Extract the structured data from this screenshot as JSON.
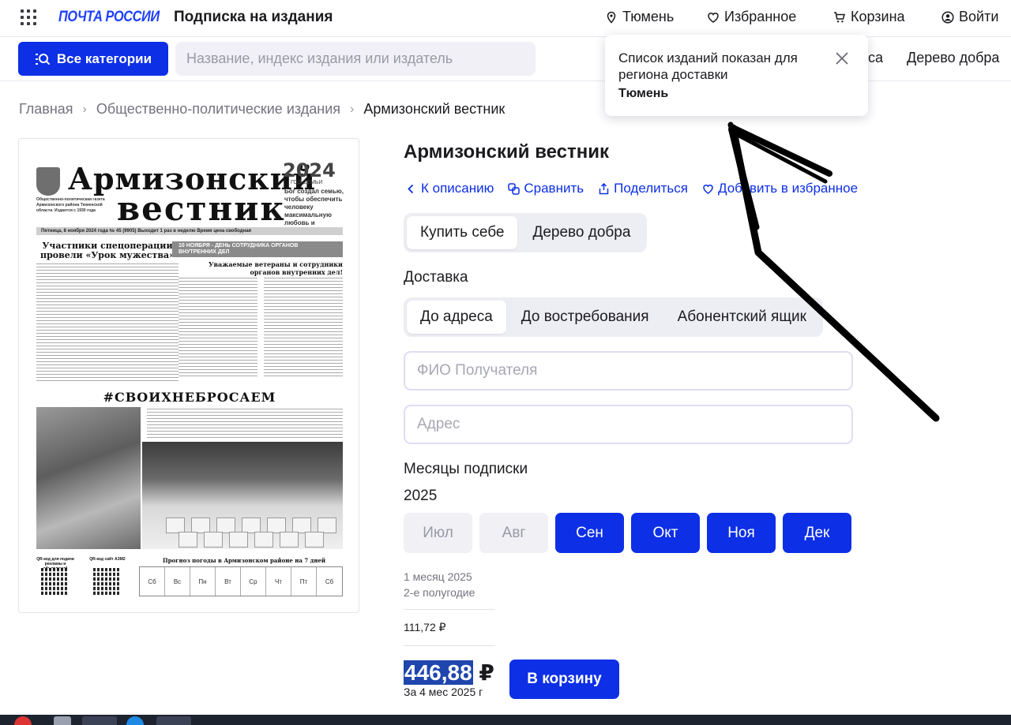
{
  "header": {
    "logo": "ПОЧТА РОССИИ",
    "service_title": "Подписка на издания",
    "city": "Тюмень",
    "favorites": "Избранное",
    "cart": "Корзина",
    "login": "Войти"
  },
  "toolbar": {
    "categories_label": "Все категории",
    "search_placeholder": "Название, индекс издания или издатель",
    "link_partial": "са",
    "link_tree": "Дерево добра"
  },
  "popup": {
    "message": "Список изданий показан для региона доставки",
    "city": "Тюмень"
  },
  "breadcrumb": {
    "home": "Главная",
    "category": "Общественно-политические издания",
    "current": "Армизонский вестник"
  },
  "cover": {
    "title_line1": "Армизонский",
    "title_line2": "вестник",
    "year": "2024",
    "year_sub": "ГОД СЕМЬИ",
    "motto": "Бог создал семью, чтобы обеспечить человеку максимальную любовь и поддержку.",
    "masthead_info": "Общественно-политическая газета Армизонского района Тюменской области. Издается с 1930 года",
    "date_bar": "Пятница, 8 ноября 2024 года     № 45 (9905)     Выходит 1 раз в неделю     Время цена свободная",
    "headline_left": "Участники спецоперации провели «Урок мужества»",
    "band": "10 НОЯБРЯ - ДЕНЬ СОТРУДНИКА ОРГАНОВ ВНУТРЕННИХ ДЕЛ",
    "headline_right": "Уважаемые ветераны и сотрудники органов внутренних дел!",
    "hashtag": "#СВОИХНЕБРОСАЕМ",
    "weather_title": "Прогноз погоды в Армизонском районе на 7 дней",
    "weather_days": [
      "Сб",
      "Вс",
      "Пн",
      "Вт",
      "Ср",
      "Чт",
      "Пт",
      "Сб"
    ],
    "qr_label_1": "QR-код для подачи рекламы и объявлений",
    "qr_label_2": "QR-код сайт АЗМ2"
  },
  "product": {
    "title": "Армизонский вестник",
    "actions": {
      "back": "К описанию",
      "compare": "Сравнить",
      "share": "Поделиться",
      "favorite": "Добавить в избранное"
    },
    "purchase_tabs": [
      "Купить себе",
      "Дерево добра"
    ],
    "delivery_label": "Доставка",
    "delivery_tabs": [
      "До адреса",
      "До востребования",
      "Абонентский ящик"
    ],
    "recipient_placeholder": "ФИО Получателя",
    "address_placeholder": "Адрес",
    "months_label": "Месяцы подписки",
    "year": "2025",
    "months": [
      {
        "label": "Июл",
        "selected": false
      },
      {
        "label": "Авг",
        "selected": false
      },
      {
        "label": "Сен",
        "selected": true
      },
      {
        "label": "Окт",
        "selected": true
      },
      {
        "label": "Ноя",
        "selected": true
      },
      {
        "label": "Дек",
        "selected": true
      }
    ],
    "period_line1": "1 месяц 2025",
    "period_line2": "2-е полугодие",
    "month_price": "111,72 ₽",
    "total_price": "446,88",
    "currency": "₽",
    "total_note": "За 4 мес 2025 г",
    "add_to_cart": "В корзину"
  },
  "colors": {
    "accent": "#0d2fe6",
    "muted_bg": "#ededf4",
    "field_border": "#dedcf6"
  }
}
